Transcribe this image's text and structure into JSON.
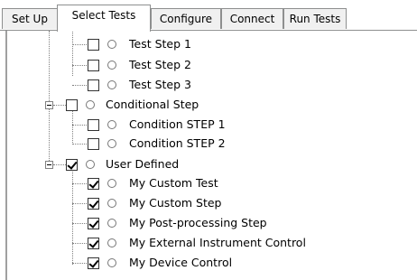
{
  "tabs": [
    {
      "label": "Set Up"
    },
    {
      "label": "Select Tests",
      "active": true
    },
    {
      "label": "Configure"
    },
    {
      "label": "Connect"
    },
    {
      "label": "Run Tests"
    }
  ],
  "tree": {
    "items": [
      {
        "label": "Test Step 1",
        "checked": false
      },
      {
        "label": "Test Step 2",
        "checked": false
      },
      {
        "label": "Test Step 3",
        "checked": false
      },
      {
        "label": "Conditional Step",
        "checked": false,
        "expanded": true
      },
      {
        "label": "Condition STEP 1",
        "checked": false
      },
      {
        "label": "Condition STEP 2",
        "checked": false
      },
      {
        "label": "User Defined",
        "checked": true,
        "expanded": true
      },
      {
        "label": "My Custom Test",
        "checked": true
      },
      {
        "label": "My Custom Step",
        "checked": true
      },
      {
        "label": "My Post-processing Step",
        "checked": true
      },
      {
        "label": "My External Instrument Control",
        "checked": true
      },
      {
        "label": "My Device Control",
        "checked": true
      }
    ]
  },
  "colors": {
    "border": "#8e8f8f",
    "tab_bg": "#f0f0f0",
    "dots": "#808080"
  },
  "icons": [
    "checkbox-icon",
    "radio-icon",
    "collapse-icon"
  ]
}
